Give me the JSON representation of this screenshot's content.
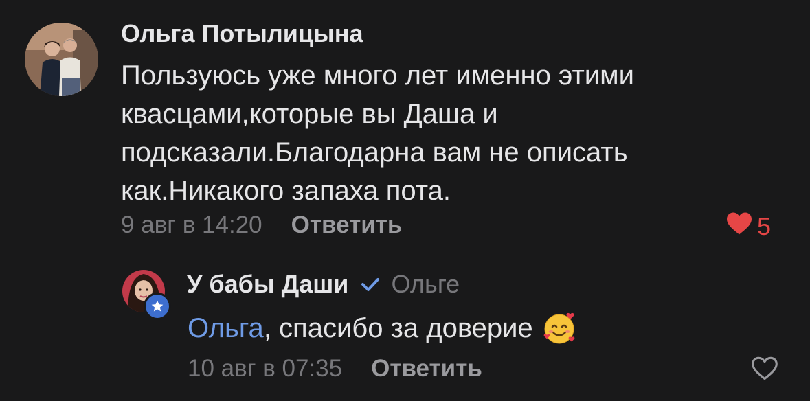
{
  "comment": {
    "author": "Ольга Потылицына",
    "text_lines": [
      "Пользуюсь уже много лет именно этими",
      "квасцами,которые вы Даша  и",
      "подсказали.Благодарна вам не описать",
      "как.Никакого запаха пота."
    ],
    "date": "9 авг в 14:20",
    "reply_label": "Ответить",
    "likes_count": "5",
    "liked": true
  },
  "reply": {
    "author": "У бабы Даши",
    "verified": true,
    "reply_to": "Ольге",
    "mention": "Ольга",
    "text": ", спасибо за доверие",
    "emoji": "smiling-face-with-hearts",
    "date": "10 авг в 07:35",
    "reply_label": "Ответить",
    "liked": false
  },
  "colors": {
    "background": "#19191a",
    "primary_text": "#e6e6e8",
    "secondary_text": "#77777b",
    "like_red": "#e64646",
    "accent_blue": "#6f9be6",
    "badge_blue": "#3d6ecf"
  }
}
